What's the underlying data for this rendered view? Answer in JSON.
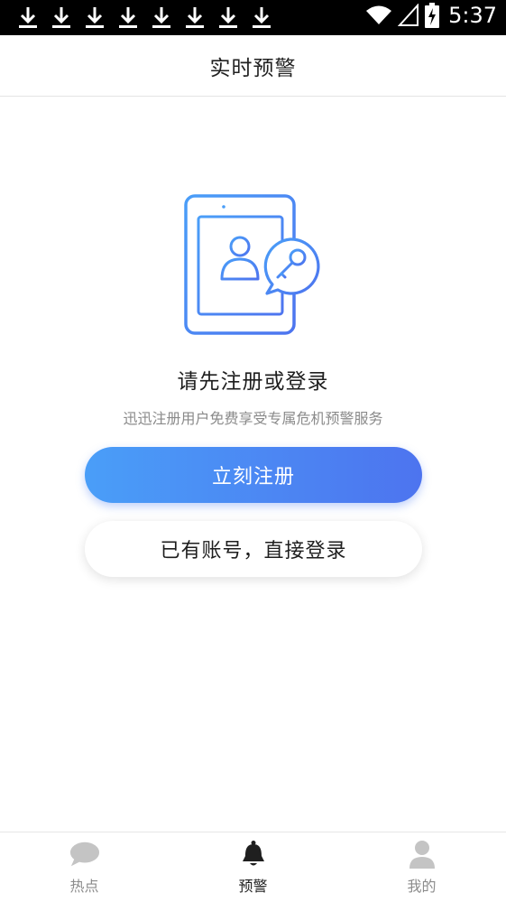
{
  "status_bar": {
    "time": "5:37",
    "download_icon_count": 8
  },
  "header": {
    "title": "实时预警"
  },
  "empty_state": {
    "title": "请先注册或登录",
    "subtitle": "迅迅注册用户免费享受专属危机预警服务",
    "illustration_icon": "tablet-user-key-icon"
  },
  "buttons": {
    "register_label": "立刻注册",
    "login_label": "已有账号，直接登录"
  },
  "bottom_nav": {
    "items": [
      {
        "label": "热点",
        "icon": "chat-bubble-icon",
        "active": false
      },
      {
        "label": "预警",
        "icon": "bell-icon",
        "active": true
      },
      {
        "label": "我的",
        "icon": "person-icon",
        "active": false
      }
    ]
  },
  "colors": {
    "accent": "#4d86f4",
    "gradient_start": "#4a9ef8",
    "gradient_end": "#4d74ef",
    "nav_inactive": "#c4c4c4",
    "nav_active": "#1f1f1f"
  }
}
